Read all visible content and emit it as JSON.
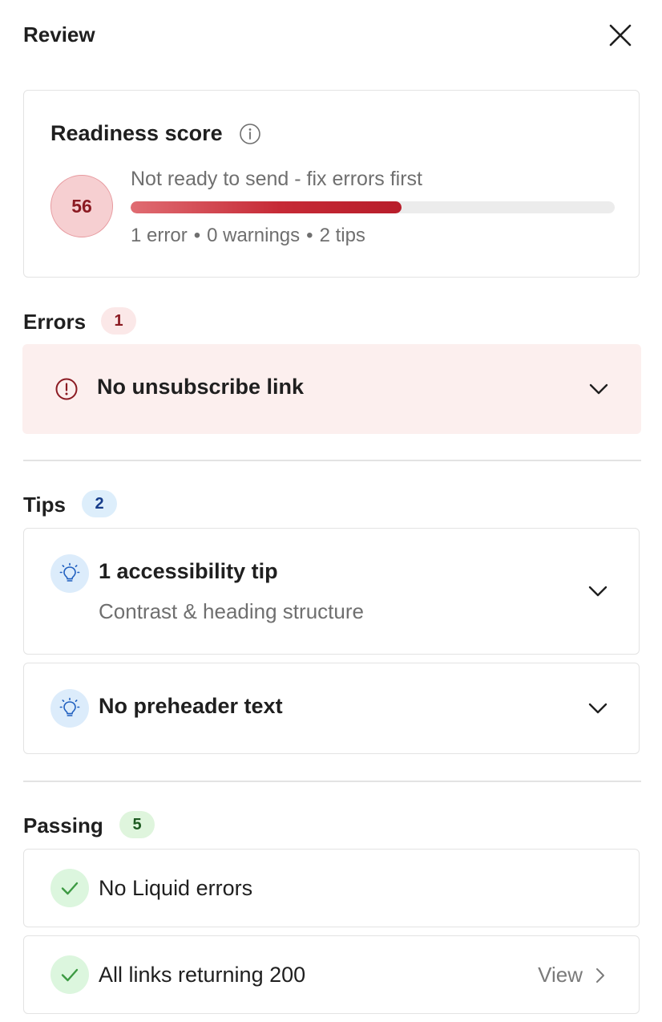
{
  "header": {
    "title": "Review",
    "close_icon": "close-icon"
  },
  "readiness": {
    "title": "Readiness score",
    "info_icon": "info-icon",
    "score": "56",
    "status": "Not ready to send - fix errors first",
    "progress_fraction": 0.56,
    "counts": [
      "1 error",
      "0 warnings",
      "2 tips"
    ]
  },
  "errors": {
    "title": "Errors",
    "count": "1",
    "items": [
      {
        "label": "No unsubscribe link",
        "icon": "alert-circle-icon"
      }
    ]
  },
  "tips": {
    "title": "Tips",
    "count": "2",
    "items": [
      {
        "label": "1 accessibility tip",
        "sublabel": "Contrast & heading structure",
        "icon": "lightbulb-icon"
      },
      {
        "label": "No preheader text",
        "icon": "lightbulb-icon"
      }
    ]
  },
  "passing": {
    "title": "Passing",
    "count": "5",
    "items": [
      {
        "label": "No Liquid errors",
        "icon": "check-icon"
      },
      {
        "label": "All links returning 200",
        "icon": "check-icon",
        "action": "View"
      }
    ]
  },
  "colors": {
    "error_accent": "#8b1a22",
    "error_bg": "#fcefee",
    "tip_accent": "#1f5fbf",
    "tip_bg": "#dcecfb",
    "pass_accent": "#3d9a43",
    "pass_bg": "#dcf6de",
    "progress_fill": "#c62a36"
  }
}
